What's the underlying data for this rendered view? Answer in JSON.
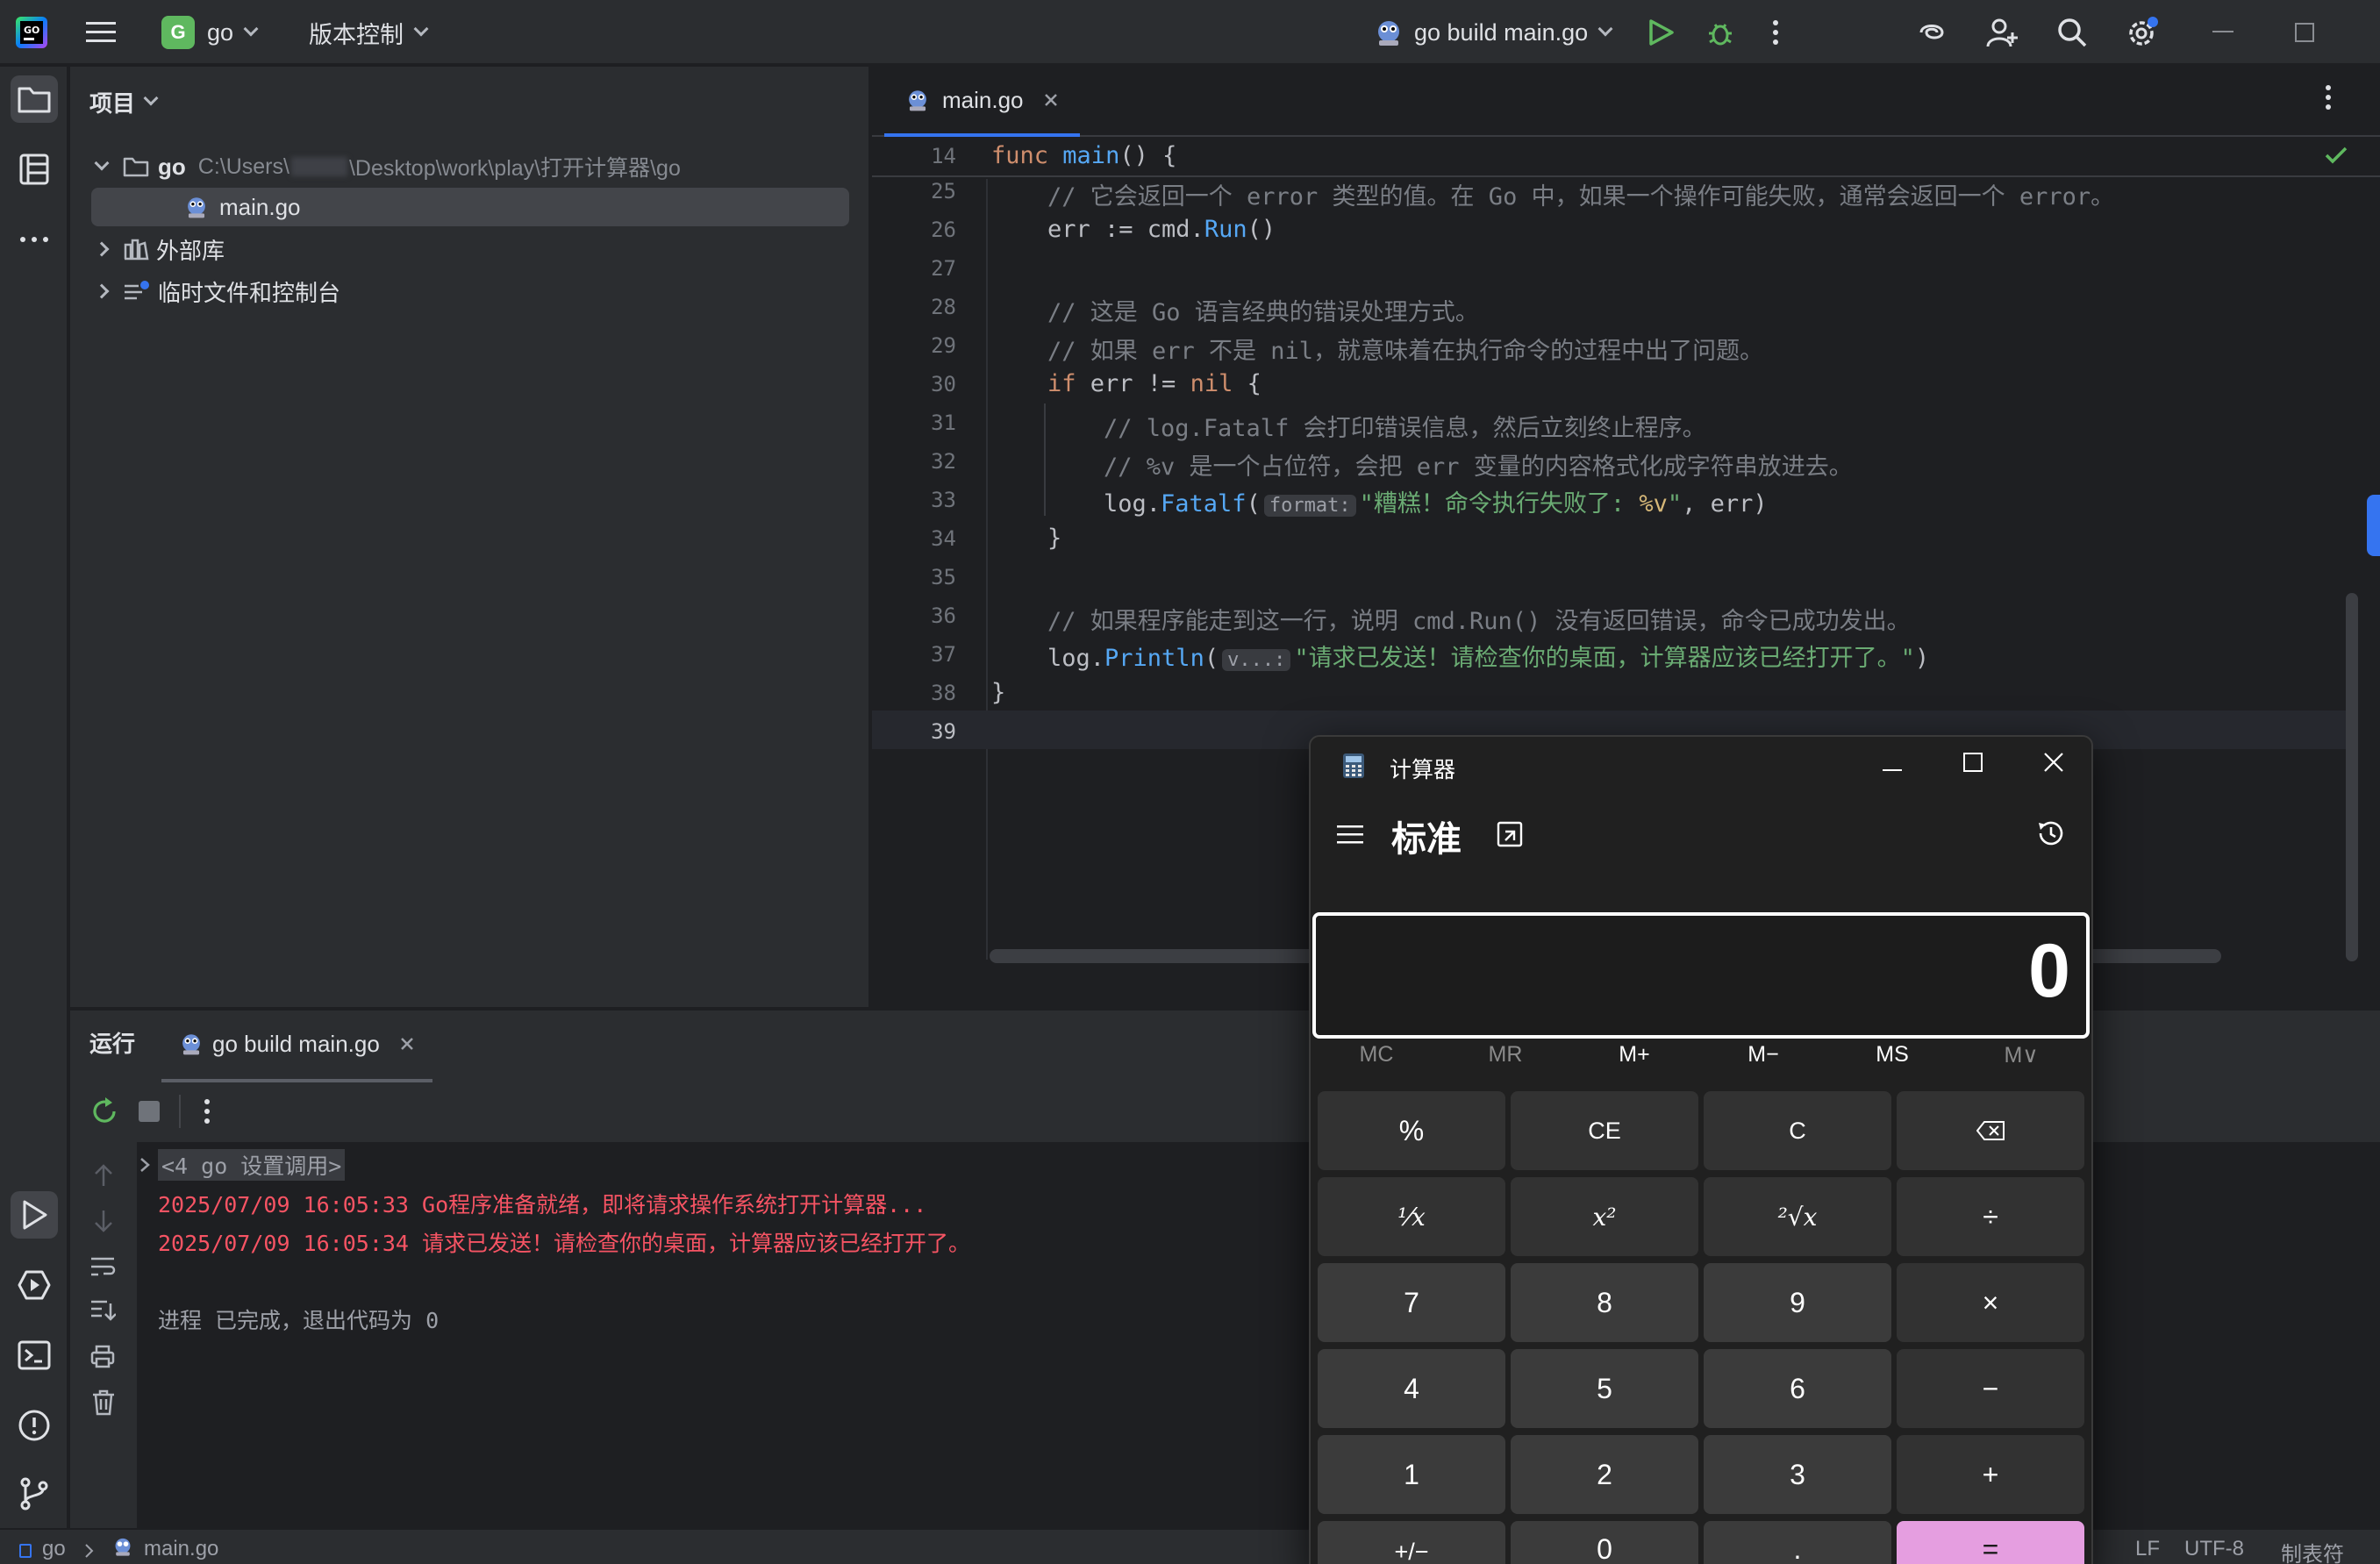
{
  "topbar": {
    "project_badge": "G",
    "project_name": "go",
    "vcs_label": "版本控制",
    "run_config": "go build main.go"
  },
  "leftstrip": {
    "icons": [
      "folder-icon",
      "structure-icon",
      "more-icon",
      "run-icon",
      "services-icon",
      "terminal-icon",
      "problems-icon",
      "git-icon"
    ]
  },
  "project": {
    "header": "项目",
    "root_name": "go",
    "root_path": "C:\\Users\\",
    "root_path_tail": "\\Desktop\\work\\play\\打开计算器\\go",
    "file": "main.go",
    "external_libs": "外部库",
    "scratches": "临时文件和控制台"
  },
  "editor": {
    "tab": "main.go",
    "sticky_line": {
      "num": "14",
      "kw": "func",
      "fn": "main",
      "rest": "() {"
    },
    "lines": [
      {
        "num": "25",
        "text": "// 它会返回一个 error 类型的值。在 Go 中，如果一个操作可能失败，通常会返回一个 error。"
      },
      {
        "num": "26",
        "a": "err := cmd.",
        "fn": "Run",
        "b": "()"
      },
      {
        "num": "27"
      },
      {
        "num": "28",
        "text": "// 这是 Go 语言经典的错误处理方式。"
      },
      {
        "num": "29",
        "text": "// 如果 err 不是 nil，就意味着在执行命令的过程中出了问题。"
      },
      {
        "num": "30",
        "kw": "if",
        "a": " err != ",
        "kw2": "nil",
        "b": " {"
      },
      {
        "num": "31",
        "text": "// log.Fatalf 会打印错误信息，然后立刻终止程序。"
      },
      {
        "num": "32",
        "text": "// %v 是一个占位符，会把 err 变量的内容格式化成字符串放进去。"
      },
      {
        "num": "33",
        "a": "log.",
        "fn": "Fatalf",
        "b": "(",
        "hint": "format:",
        "str": "\"糟糕！命令执行失败了: ",
        "fmt": "%v",
        "str2": "\"",
        "c": ", err)"
      },
      {
        "num": "34",
        "a": "}"
      },
      {
        "num": "35"
      },
      {
        "num": "36",
        "text": "// 如果程序能走到这一行，说明 cmd.Run() 没有返回错误，命令已成功发出。"
      },
      {
        "num": "37",
        "a": "log.",
        "fn": "Println",
        "b": "(",
        "hint": "v...:",
        "str": "\"请求已发送！请检查你的桌面，计算器应该已经打开了。\"",
        "c": ")"
      },
      {
        "num": "38",
        "a": "}"
      },
      {
        "num": "39"
      }
    ]
  },
  "run": {
    "header": "运行",
    "tab": "go build main.go",
    "console": [
      "<4 go 设置调用>",
      "2025/07/09 16:05:33 Go程序准备就绪，即将请求操作系统打开计算器...",
      "2025/07/09 16:05:34 请求已发送！请检查你的桌面，计算器应该已经打开了。",
      "进程 已完成，退出代码为 0"
    ]
  },
  "status": {
    "crumb1": "go",
    "crumb2": "main.go",
    "line_sep": "LF",
    "encoding": "UTF-8",
    "indent": "制表符"
  },
  "calculator": {
    "title": "计算器",
    "mode": "标准",
    "display": "0",
    "memory": [
      "MC",
      "MR",
      "M+",
      "M−",
      "MS",
      "M∨"
    ],
    "keys": [
      [
        "%",
        "CE",
        "C",
        "⌫"
      ],
      [
        "¹⁄x",
        "x²",
        "²√x",
        "÷"
      ],
      [
        "7",
        "8",
        "9",
        "×"
      ],
      [
        "4",
        "5",
        "6",
        "−"
      ],
      [
        "1",
        "2",
        "3",
        "+"
      ],
      [
        "+/−",
        "0",
        ".",
        "="
      ]
    ],
    "accent": "#e59ee0"
  }
}
